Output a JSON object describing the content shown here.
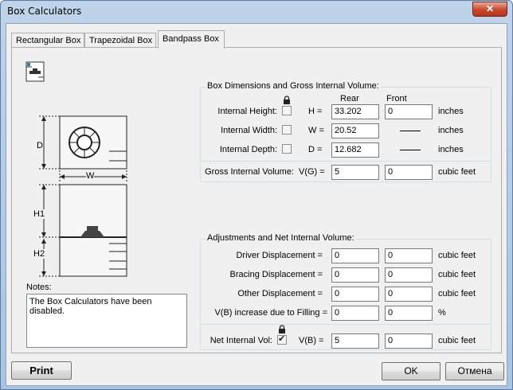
{
  "window": {
    "title": "Box Calculators",
    "close_glyph": "✕"
  },
  "tabs": [
    {
      "label": "Rectangular Box"
    },
    {
      "label": "Trapezoidal Box"
    },
    {
      "label": "Bandpass Box",
      "active": true
    }
  ],
  "diagram": {
    "d": "D",
    "w": "W",
    "h1": "H1",
    "h2": "H2"
  },
  "dimensions": {
    "legend": "Box Dimensions and Gross Internal Volume:",
    "col_rear": "Rear",
    "col_front": "Front",
    "rows": [
      {
        "label": "Internal Height:",
        "symbol": "H =",
        "rear": "33.202",
        "front": "0",
        "unit": "inches",
        "checked": false
      },
      {
        "label": "Internal Width:",
        "symbol": "W =",
        "rear": "20.52",
        "front": "",
        "unit": "inches",
        "checked": false
      },
      {
        "label": "Internal Depth:",
        "symbol": "D =",
        "rear": "12.682",
        "front": "",
        "unit": "inches",
        "checked": false
      }
    ],
    "gross": {
      "label": "Gross Internal Volume:",
      "symbol": "V(G) =",
      "rear": "5",
      "front": "0",
      "unit": "cubic feet"
    }
  },
  "adjustments": {
    "legend": "Adjustments and Net Internal Volume:",
    "rows": [
      {
        "label": "Driver Displacement  =",
        "rear": "0",
        "front": "0",
        "unit": "cubic feet"
      },
      {
        "label": "Bracing Displacement  =",
        "rear": "0",
        "front": "0",
        "unit": "cubic feet"
      },
      {
        "label": "Other Displacement  =",
        "rear": "0",
        "front": "0",
        "unit": "cubic feet"
      },
      {
        "label": "V(B) increase due to Filling =",
        "rear": "0",
        "front": "0",
        "unit": "%"
      }
    ],
    "net": {
      "label": "Net Internal Vol:",
      "symbol": "V(B) =",
      "rear": "5",
      "front": "0",
      "unit": "cubic feet",
      "checked": true
    }
  },
  "notes": {
    "label": "Notes:",
    "text": "The Box Calculators have been disabled."
  },
  "buttons": {
    "print": "Print",
    "ok": "OK",
    "cancel": "Отмена"
  },
  "colors": {
    "title_gradient_top": "#bfd3ea",
    "close_red": "#c7472d",
    "panel_bg": "#f0f0f0"
  }
}
